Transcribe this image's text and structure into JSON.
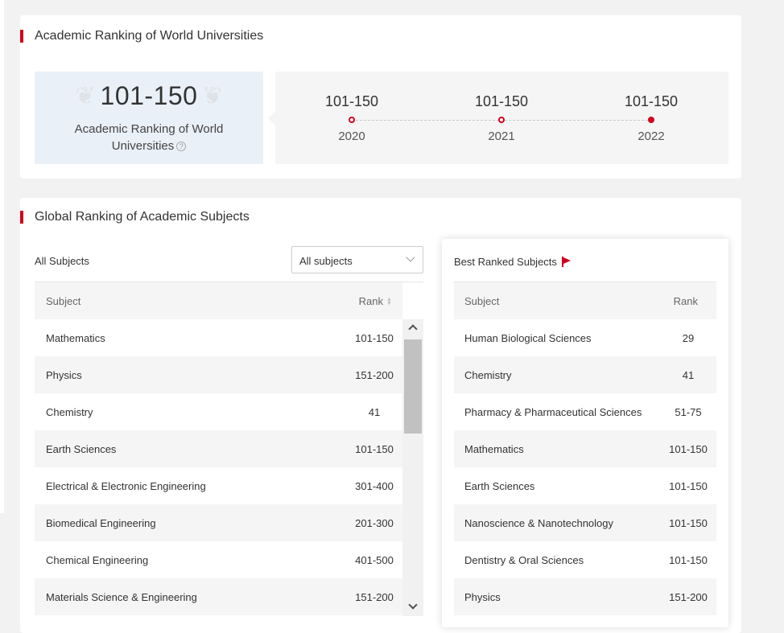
{
  "arwu": {
    "title": "Academic Ranking of World Universities",
    "rank": "101-150",
    "caption_line1": "Academic Ranking of World",
    "caption_line2": "Universities",
    "help_icon": "?",
    "timeline": [
      {
        "rank": "101-150",
        "year": "2020",
        "current": false
      },
      {
        "rank": "101-150",
        "year": "2021",
        "current": false
      },
      {
        "rank": "101-150",
        "year": "2022",
        "current": true
      }
    ]
  },
  "gras": {
    "title": "Global Ranking of Academic Subjects",
    "all_subjects_label": "All Subjects",
    "select_value": "All subjects",
    "table": {
      "col_subject": "Subject",
      "col_rank": "Rank",
      "rows": [
        {
          "subject": "Mathematics",
          "rank": "101-150"
        },
        {
          "subject": "Physics",
          "rank": "151-200"
        },
        {
          "subject": "Chemistry",
          "rank": "41"
        },
        {
          "subject": "Earth Sciences",
          "rank": "101-150"
        },
        {
          "subject": "Electrical & Electronic Engineering",
          "rank": "301-400"
        },
        {
          "subject": "Biomedical Engineering",
          "rank": "201-300"
        },
        {
          "subject": "Chemical Engineering",
          "rank": "401-500"
        },
        {
          "subject": "Materials Science & Engineering",
          "rank": "151-200"
        }
      ]
    },
    "best": {
      "title": "Best Ranked Subjects",
      "col_subject": "Subject",
      "col_rank": "Rank",
      "rows": [
        {
          "subject": "Human Biological Sciences",
          "rank": "29"
        },
        {
          "subject": "Chemistry",
          "rank": "41"
        },
        {
          "subject": "Pharmacy & Pharmaceutical Sciences",
          "rank": "51-75"
        },
        {
          "subject": "Mathematics",
          "rank": "101-150"
        },
        {
          "subject": "Earth Sciences",
          "rank": "101-150"
        },
        {
          "subject": "Nanoscience & Nanotechnology",
          "rank": "101-150"
        },
        {
          "subject": "Dentistry & Oral Sciences",
          "rank": "101-150"
        },
        {
          "subject": "Physics",
          "rank": "151-200"
        }
      ]
    }
  },
  "colors": {
    "accent": "#d0021b",
    "panel": "#eaf0f8",
    "stripe": "#f5f5f5"
  }
}
